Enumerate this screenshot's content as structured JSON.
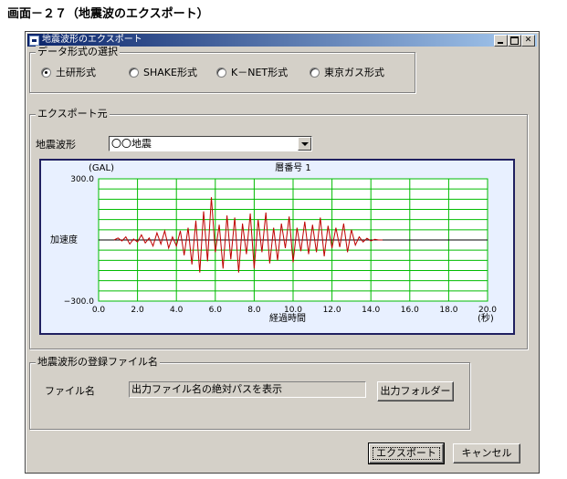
{
  "caption": "画面－２７（地震波のエクスポート）",
  "window": {
    "title": "地震波形のエクスポート"
  },
  "format_group": {
    "label": "データ形式の選択",
    "options": [
      {
        "label": "土研形式",
        "checked": true
      },
      {
        "label": "SHAKE形式",
        "checked": false
      },
      {
        "label": "K－NET形式",
        "checked": false
      },
      {
        "label": "東京ガス形式",
        "checked": false
      }
    ]
  },
  "source_group": {
    "label": "エクスポート元",
    "waveform_label": "地震波形",
    "waveform_value": "〇〇地震"
  },
  "chart_data": {
    "type": "line",
    "title": "層番号 1",
    "unit_y": "(GAL)",
    "unit_x": "(秒)",
    "ylabel": "加速度",
    "xlabel": "経過時間",
    "ylim": [
      -300,
      300
    ],
    "xlim": [
      0,
      20
    ],
    "y_tick_labels": [
      "300.0",
      "−300.0"
    ],
    "x_tick_labels": [
      "0.0",
      "2.0",
      "4.0",
      "6.0",
      "8.0",
      "10.0",
      "12.0",
      "14.0",
      "16.0",
      "18.0",
      "20.0"
    ],
    "grid": true,
    "colors": {
      "line": "#c00000",
      "grid": "#00bb00",
      "axis": "#000000"
    },
    "series": [
      {
        "x": [
          0.8,
          1.0,
          1.2,
          1.4,
          1.6,
          1.8,
          2.0,
          2.2,
          2.4,
          2.6,
          2.8,
          3.0,
          3.2,
          3.4,
          3.6,
          3.8,
          4.0,
          4.2,
          4.4,
          4.6,
          4.8,
          5.0,
          5.2,
          5.4,
          5.6,
          5.8,
          6.0,
          6.2,
          6.4,
          6.6,
          6.8,
          7.0,
          7.2,
          7.4,
          7.6,
          7.8,
          8.0,
          8.2,
          8.4,
          8.6,
          8.8,
          9.0,
          9.2,
          9.4,
          9.6,
          9.8,
          10.0,
          10.2,
          10.4,
          10.6,
          10.8,
          11.0,
          11.2,
          11.4,
          11.6,
          11.8,
          12.0,
          12.2,
          12.4,
          12.6,
          12.8,
          13.0,
          13.2,
          13.4,
          13.6,
          13.8,
          14.0,
          14.2,
          14.4,
          14.6
        ],
        "y": [
          0,
          10,
          -5,
          15,
          -20,
          5,
          -10,
          25,
          -15,
          10,
          -30,
          35,
          -20,
          45,
          -40,
          15,
          -30,
          45,
          -75,
          60,
          -120,
          95,
          -160,
          140,
          -105,
          210,
          -60,
          75,
          -140,
          120,
          -95,
          110,
          -160,
          80,
          -70,
          130,
          -140,
          100,
          -60,
          135,
          -115,
          60,
          -100,
          80,
          -40,
          115,
          -110,
          60,
          -55,
          90,
          -70,
          75,
          -60,
          110,
          -80,
          70,
          -40,
          60,
          -35,
          80,
          -60,
          50,
          -25,
          15,
          -10,
          8,
          -5,
          3,
          0,
          0
        ]
      }
    ]
  },
  "file_group": {
    "label": "地震波形の登録ファイル名",
    "file_label": "ファイル名",
    "file_value": "出力ファイル名の絶対パスを表示",
    "folder_button": "出力フォルダー"
  },
  "buttons": {
    "export": "エクスポート",
    "cancel": "キャンセル"
  }
}
